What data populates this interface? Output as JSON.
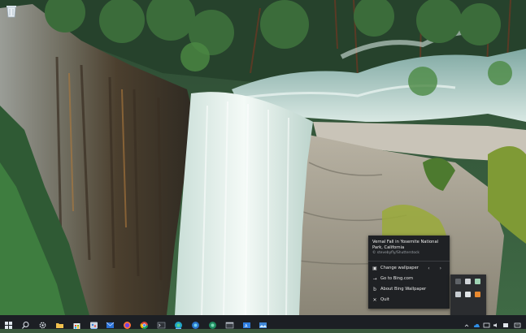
{
  "desktop": {
    "wallpaper_caption": "Vernal Fall in Yosemite National Park, California",
    "wallpaper_credit": "© stevebyfly/Shutterstock"
  },
  "menu": {
    "items": [
      {
        "icon": "picture-icon",
        "label": "Change wallpaper",
        "nav": "‹ ›"
      },
      {
        "icon": "arrow-icon",
        "label": "Go to Bing.com"
      },
      {
        "icon": "bing-icon",
        "label": "About Bing Wallpaper"
      },
      {
        "icon": "close-icon",
        "label": "Quit"
      }
    ]
  },
  "taskbar": {
    "apps": [
      "start-icon",
      "search-icon",
      "settings-icon",
      "file-explorer-icon",
      "store-icon",
      "paint-icon",
      "mail-icon",
      "firefox-icon",
      "chrome-icon",
      "terminal-icon",
      "edge-icon",
      "edge-beta-icon",
      "edge-dev-icon",
      "edge-canary-icon",
      "window-icon",
      "note-icon",
      "remote-desktop-icon",
      "bing-wallpaper-icon"
    ],
    "tray": [
      "chevron-up-icon",
      "cloud-icon",
      "monitor-icon",
      "speaker-icon",
      "network-icon",
      "notification-icon"
    ]
  },
  "colors": {
    "taskbar": "#1c1f24",
    "menu": "#1f2124",
    "accent": "#7fb4ff"
  }
}
